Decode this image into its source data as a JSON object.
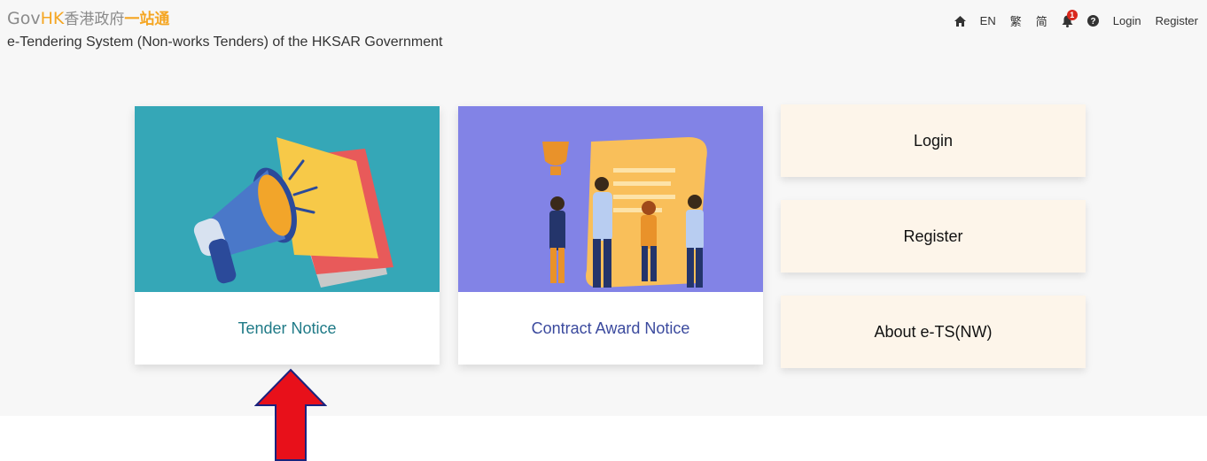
{
  "header": {
    "logo": {
      "gov": "Gov",
      "hk": "HK",
      "zh_part1": "香港政府",
      "zh_part2": "一站通"
    },
    "subtitle": "e-Tendering System (Non-works Tenders) of the HKSAR Government"
  },
  "topnav": {
    "home_icon": "home-icon",
    "lang_en": "EN",
    "lang_tc": "繁",
    "lang_sc": "简",
    "notification_count": "1",
    "help_icon": "question-circle-icon",
    "login": "Login",
    "register": "Register"
  },
  "cards": {
    "tender_notice": "Tender Notice",
    "contract_award_notice": "Contract Award Notice"
  },
  "side_buttons": {
    "login": "Login",
    "register": "Register",
    "about": "About e-TS(NW)"
  },
  "colors": {
    "tender_bg": "#35a7b7",
    "award_bg": "#8283e6",
    "side_btn_bg": "#fdf5ea",
    "arrow_red": "#e8101a",
    "arrow_outline": "#1a237e"
  }
}
